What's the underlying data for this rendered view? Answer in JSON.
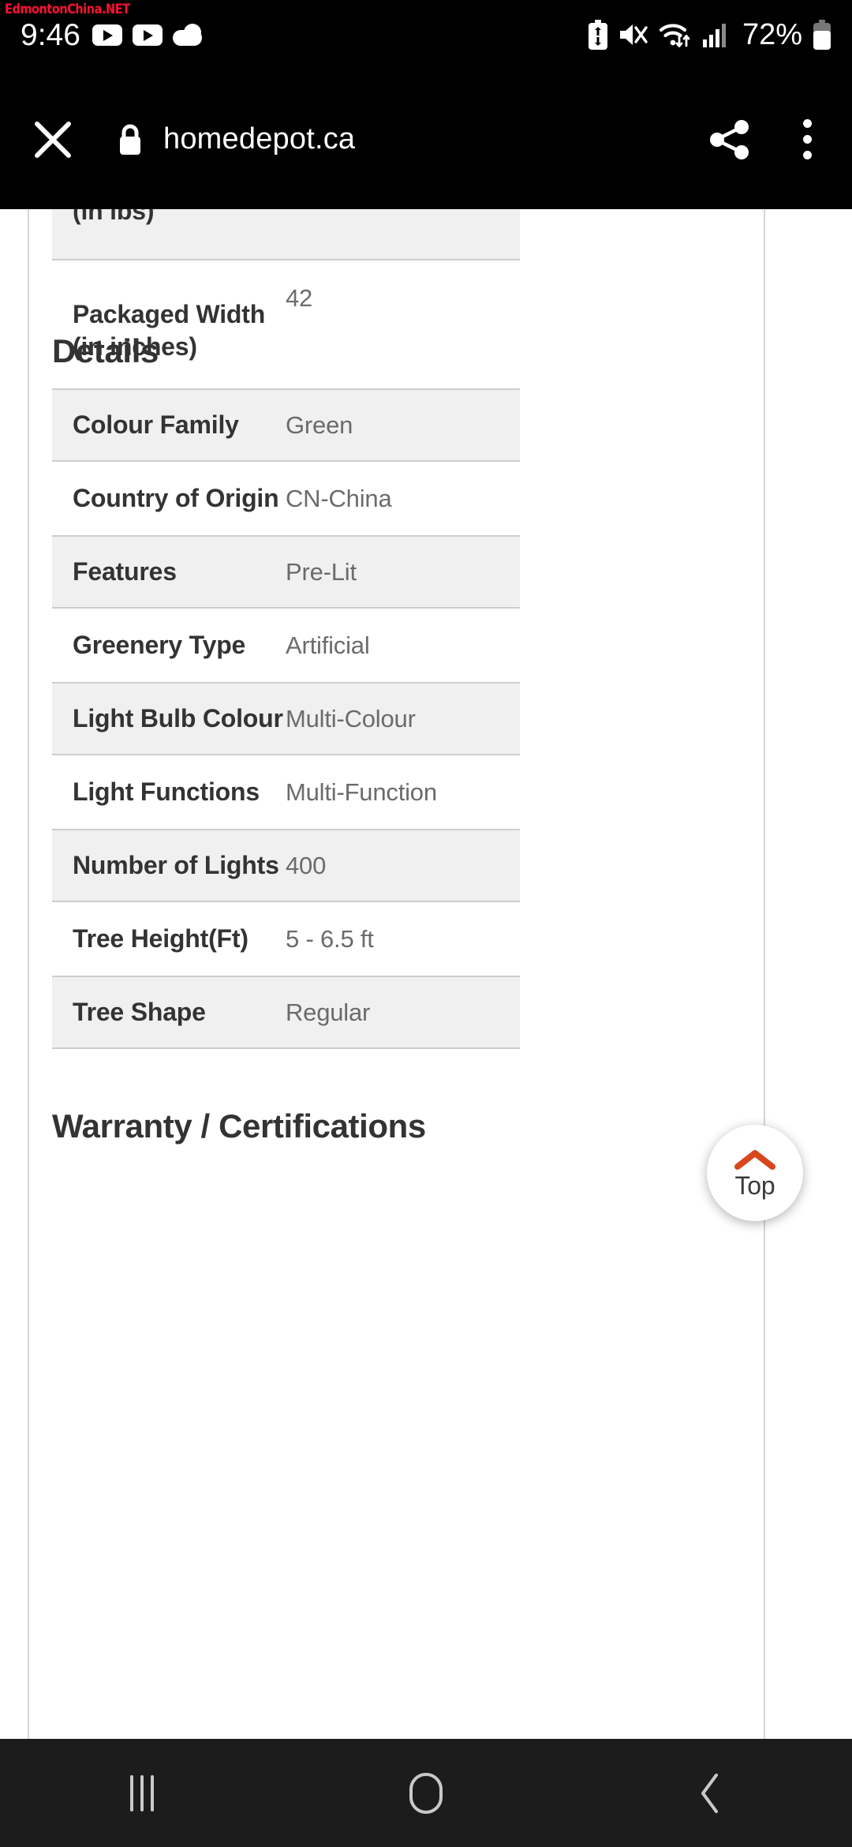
{
  "watermark": "EdmontonChina.NET",
  "status_bar": {
    "time": "9:46",
    "battery_percent": "72%",
    "icons": [
      "youtube-icon",
      "youtube-icon",
      "weather-cloud-icon",
      "battery-saver-icon",
      "mute-icon",
      "wifi-icon",
      "cellular-signal-icon",
      "battery-icon"
    ]
  },
  "browser": {
    "url": "homedepot.ca",
    "close_icon": "close-icon",
    "lock_icon": "lock-icon",
    "share_icon": "share-icon",
    "menu_icon": "overflow-menu-icon"
  },
  "page": {
    "clipped_row": {
      "label": "(in lbs)",
      "value": ""
    },
    "packaged_row": {
      "label": "Packaged Width (in inches)",
      "value": "42"
    },
    "details_heading": "Details",
    "details_rows": [
      {
        "label": "Colour Family",
        "value": "Green"
      },
      {
        "label": "Country of Origin",
        "value": "CN-China"
      },
      {
        "label": "Features",
        "value": "Pre-Lit"
      },
      {
        "label": "Greenery Type",
        "value": "Artificial"
      },
      {
        "label": "Light Bulb Colour",
        "value": "Multi-Colour"
      },
      {
        "label": "Light Functions",
        "value": "Multi-Function"
      },
      {
        "label": "Number of Lights",
        "value": "400"
      },
      {
        "label": "Tree Height(Ft)",
        "value": "5 - 6.5 ft"
      },
      {
        "label": "Tree Shape",
        "value": "Regular"
      }
    ],
    "warranty_heading": "Warranty / Certifications"
  },
  "top_button": {
    "label": "Top",
    "icon": "chevron-up-icon",
    "accent_color": "#d9461b"
  },
  "nav_bar": {
    "recent_label": "recent-apps-icon",
    "home_label": "home-icon",
    "back_label": "back-icon"
  }
}
